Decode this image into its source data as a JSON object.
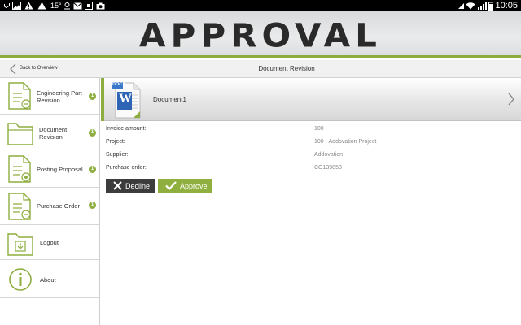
{
  "status_bar": {
    "temperature": "15°",
    "time": "10:05"
  },
  "header": {
    "title": "APPROVAL"
  },
  "subheader": {
    "back_label": "Back to Overview",
    "title": "Document Revision"
  },
  "sidebar": {
    "items": [
      {
        "label_line1": "Engineering Part",
        "label_line2": "Revision",
        "badge": "1"
      },
      {
        "label_line1": "Document",
        "label_line2": "Revision",
        "badge": "1"
      },
      {
        "label_line1": "Posting Proposal",
        "label_line2": "",
        "badge": "1"
      },
      {
        "label_line1": "Purchase Order",
        "label_line2": "",
        "badge": "1"
      },
      {
        "label_line1": "Logout",
        "label_line2": ""
      },
      {
        "label_line1": "About",
        "label_line2": ""
      }
    ]
  },
  "document": {
    "icon_badge": "DOCX",
    "icon_letter": "W",
    "name": "Document1"
  },
  "details": {
    "invoice_amount_label": "Invoice amount:",
    "invoice_amount_value": "100",
    "project_label": "Project:",
    "project_value": "100 - Addovation Project",
    "supplier_label": "Supplier:",
    "supplier_value": "Addovation",
    "purchase_order_label": "Purchase order:",
    "purchase_order_value": "CO139853"
  },
  "actions": {
    "decline_label": "Decline",
    "approve_label": "Approve"
  },
  "colors": {
    "accent_green": "#8dad3e",
    "dark_button": "#3c3c3c",
    "status_bar": "#000000"
  }
}
